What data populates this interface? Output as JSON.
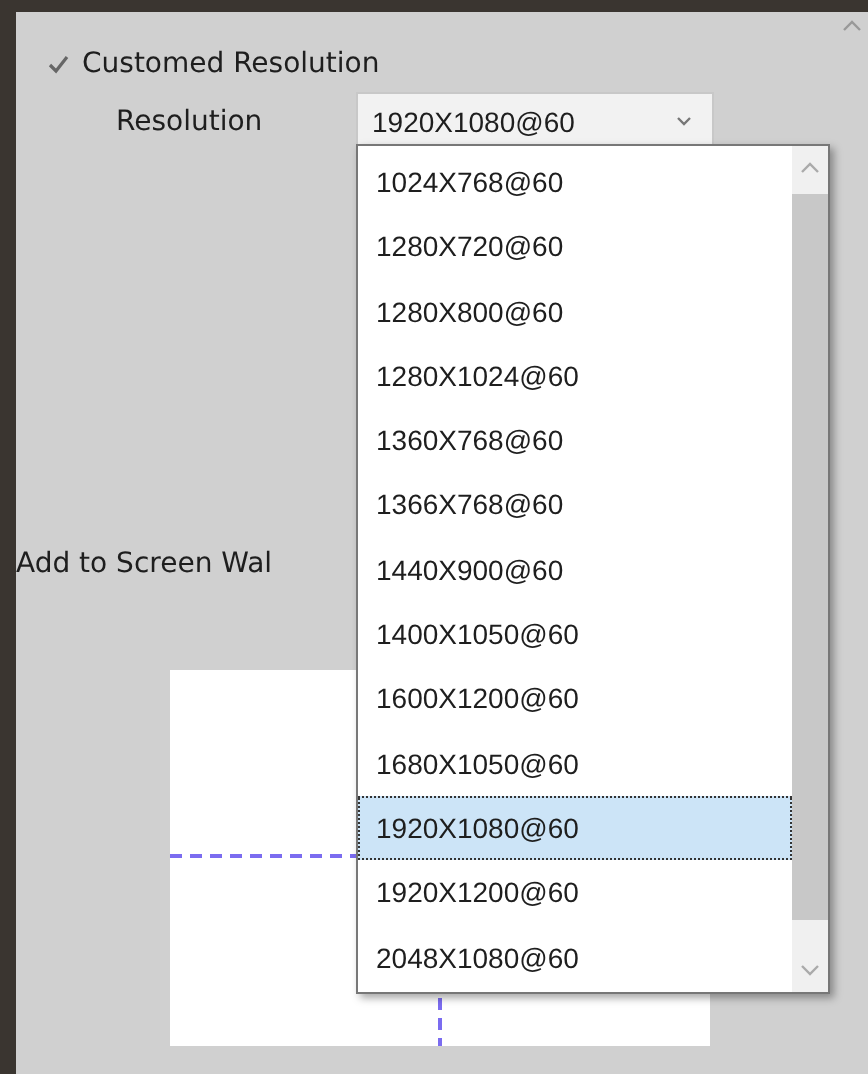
{
  "custom_resolution": {
    "label": "Customed Resolution",
    "checked": true
  },
  "resolution": {
    "label": "Resolution",
    "value": "1920X1080@60",
    "expanded": true,
    "options": [
      {
        "label": "1024X768@60",
        "selected": false
      },
      {
        "label": "1280X720@60",
        "selected": false
      },
      {
        "label": "1280X800@60",
        "selected": false
      },
      {
        "label": "1280X1024@60",
        "selected": false
      },
      {
        "label": "1360X768@60",
        "selected": false
      },
      {
        "label": "1366X768@60",
        "selected": false
      },
      {
        "label": "1440X900@60",
        "selected": false
      },
      {
        "label": "1400X1050@60",
        "selected": false
      },
      {
        "label": "1600X1200@60",
        "selected": false
      },
      {
        "label": "1680X1050@60",
        "selected": false
      },
      {
        "label": "1920X1080@60",
        "selected": true
      },
      {
        "label": "1920X1200@60",
        "selected": false
      },
      {
        "label": "2048X1080@60",
        "selected": false
      }
    ]
  },
  "screen_wall": {
    "label": "Add to Screen Wal"
  }
}
